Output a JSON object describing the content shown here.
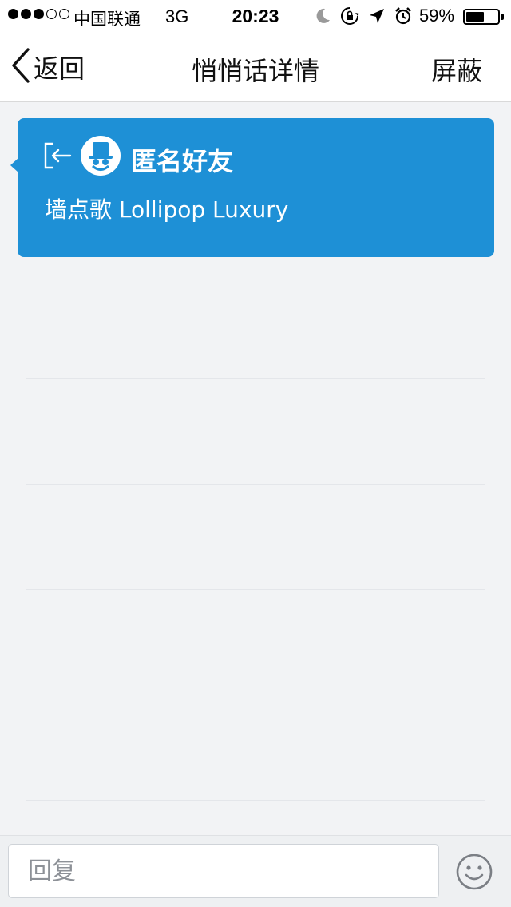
{
  "status_bar": {
    "carrier": "中国联通",
    "network": "3G",
    "time": "20:23",
    "battery_percent": "59%",
    "battery_level": 0.59,
    "signal_bars_filled": 3,
    "signal_bars_total": 5,
    "icons": [
      "moon-icon",
      "rotation-lock-icon",
      "location-arrow-icon",
      "alarm-icon",
      "battery-icon"
    ]
  },
  "nav": {
    "back_label": "返回",
    "title": "悄悄话详情",
    "block_label": "屏蔽"
  },
  "message": {
    "sender": "匿名好友",
    "text": "墙点歌 Lollipop Luxury",
    "accent_color": "#1e90d6"
  },
  "reply": {
    "placeholder": "回复",
    "value": ""
  }
}
